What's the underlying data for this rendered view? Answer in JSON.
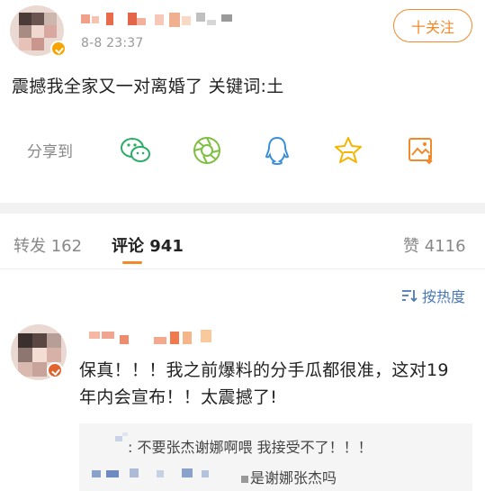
{
  "post": {
    "time": "8-8 23:37",
    "follow_label": "十关注",
    "text": "震撼我全家又一对离婚了 关键词:土"
  },
  "share": {
    "label": "分享到",
    "icons": [
      "wechat-icon",
      "moments-icon",
      "qq-icon",
      "qzone-star-icon",
      "save-image-icon"
    ],
    "colors": {
      "wechat": "#2aae67",
      "moments": "#7fbf3f",
      "qq": "#3a8fd9",
      "star": "#f5b400",
      "image": "#f28a2a"
    }
  },
  "tabs": {
    "repost": "转发 162",
    "comments": "评论 941",
    "likes": "赞 4116"
  },
  "sort": {
    "label": "按热度"
  },
  "comment": {
    "text": "保真！！！我之前爆料的分手瓜都很准，这对19年内会宣布！！太震撼了!",
    "replies": [
      ": 不要张杰谢娜啊喂 我接受不了！！！",
      "是谢娜张杰吗"
    ]
  },
  "accent_color": "#f28a2a",
  "link_color": "#4a79b5"
}
